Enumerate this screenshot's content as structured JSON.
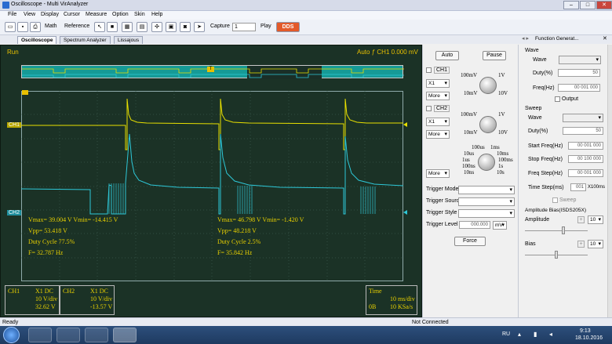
{
  "window": {
    "title": "Oscilloscope - Multi VirAnalyzer",
    "minimize": "–",
    "maximize": "□",
    "close": "✕"
  },
  "menu": [
    "File",
    "View",
    "Display",
    "Cursor",
    "Measure",
    "Option",
    "Skin",
    "Help"
  ],
  "toolbar": {
    "math": "Math",
    "reference": "Reference",
    "capture": "Capture",
    "capture_value": "1",
    "play": "Play",
    "dds": "DDS"
  },
  "tabs": [
    "Oscilloscope",
    "Spectrum Analyzer",
    "Lissajous"
  ],
  "scope": {
    "run": "Run",
    "trigger": {
      "mode": "Auto",
      "symbol": "ƒ",
      "channel": "CH1",
      "level": "0.000 mV"
    },
    "marker_t": "T",
    "ch1_label": "CH1",
    "ch2_label": "CH2",
    "meas_left": [
      "Vmax= 39.004 V  Vmin= -14.415 V",
      "Vpp= 53.418 V",
      "Duty Cycle 77.5%",
      "F= 32.787 Hz"
    ],
    "meas_right": [
      "Vmax= 46.798 V  Vmin= -1.420 V",
      "Vpp= 48.218 V",
      "Duty Cycle 2.5%",
      "F= 35.842 Hz"
    ],
    "ch1_box": {
      "name": "CH1",
      "probe": "X1  DC",
      "vdiv": "10 V/div",
      "offset": "32.62 V"
    },
    "ch2_box": {
      "name": "CH2",
      "probe": "X1  DC",
      "vdiv": "10 V/div",
      "offset": "-13.57 V"
    },
    "time_box": {
      "name": "Time",
      "tdiv": "10 ms/div",
      "pos": "0B",
      "rate": "10 KSa/s"
    }
  },
  "controls": {
    "auto": "Auto",
    "pause": "Pause",
    "ch1": "CH1",
    "ch2": "CH2",
    "probe": "X1",
    "more": "More",
    "volt_labels": {
      "tl": "100mV",
      "tr": "1V",
      "bl": "10mV",
      "br": "10V"
    },
    "time_labels": [
      "100us",
      "1ms",
      "10us",
      "10ms",
      "1us",
      "100ms",
      "100ns",
      "1s",
      "10ns",
      "10s"
    ],
    "trigger_mode": "Trigger Mode",
    "trigger_source": "Trigger Source",
    "trigger_style": "Trigger Style",
    "trigger_level": "Trigger Level",
    "trigger_level_value": "000.000",
    "trigger_level_unit": "mV",
    "force": "Force"
  },
  "function_generator": {
    "title": "Function Generat...",
    "wave_header": "Wave",
    "wave": "Wave",
    "duty": "Duty(%)",
    "duty_value": "50",
    "freq": "Freq(Hz)",
    "freq_value": "00 001 000",
    "output": "Output",
    "sweep_header": "Sweep",
    "sweep_wave": "Wave",
    "sweep_duty": "Duty(%)",
    "sweep_duty_value": "50",
    "start_freq": "Start Freq(Hz)",
    "start_value": "00 001 000",
    "stop_freq": "Stop Freq(Hz)",
    "stop_value": "00 100 000",
    "freq_step": "Freq Step(Hz)",
    "step_value": "00 001 000",
    "time_step": "Time Step(ms)",
    "time_step_value": "001",
    "time_step_unit": "X100ms",
    "sweep_check": "Sweep",
    "amp_bias": "Amplitude Bias(ISDS205X)",
    "amplitude": "Amplitude",
    "amp_value": "10",
    "bias": "Bias",
    "bias_value": "10"
  },
  "status": {
    "left": "Ready",
    "center": "Not Connected"
  },
  "taskbar": {
    "lang": "RU",
    "time": "9:13",
    "date": "18.10.2016"
  },
  "colors": {
    "ch1": "#e8e000",
    "ch2": "#2ec8d8",
    "accent": "#e8c000"
  }
}
